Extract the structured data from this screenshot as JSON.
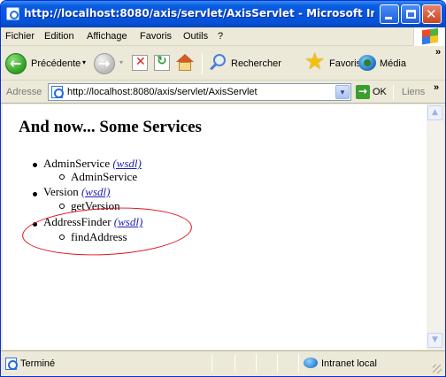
{
  "window": {
    "title": "http://localhost:8080/axis/servlet/AxisServlet - Microsoft Internet ...",
    "close_glyph": "✕"
  },
  "menu": {
    "items": [
      {
        "label": "Fichier"
      },
      {
        "label": "Edition"
      },
      {
        "label": "Affichage"
      },
      {
        "label": "Favoris"
      },
      {
        "label": "Outils"
      },
      {
        "label": "?"
      }
    ]
  },
  "toolbar": {
    "back_label": "Précédente",
    "search_label": "Rechercher",
    "favorites_label": "Favoris",
    "media_label": "Média",
    "dropdown_glyph": "▾",
    "overflow_glyph": "»"
  },
  "address": {
    "label": "Adresse",
    "url": "http://localhost:8080/axis/servlet/AxisServlet",
    "go_label": "OK",
    "links_label": "Liens",
    "overflow_glyph": "»"
  },
  "page": {
    "title": "And now... Some Services",
    "services": [
      {
        "name": "AdminService",
        "wsdl": "(wsdl)",
        "operations": [
          "AdminService"
        ]
      },
      {
        "name": "Version",
        "wsdl": "(wsdl)",
        "operations": [
          "getVersion"
        ]
      },
      {
        "name": "AddressFinder",
        "wsdl": "(wsdl)",
        "operations": [
          "findAddress"
        ],
        "highlighted": true
      }
    ]
  },
  "status": {
    "text": "Terminé",
    "zone": "Intranet local"
  },
  "colors": {
    "titlebar": "#0554e3",
    "link": "#1f1fb5",
    "highlight_ellipse": "#e0101a"
  }
}
